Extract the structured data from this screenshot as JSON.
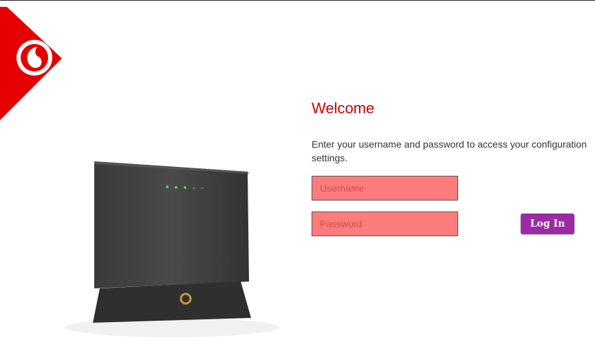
{
  "brand": {
    "logo": "vodafone-logo-icon",
    "accent_color": "#e60000",
    "button_color": "#9c2aa0"
  },
  "login": {
    "welcome": "Welcome",
    "intro": "Enter your username and password to access your configuration settings.",
    "username_placeholder": "Username",
    "password_placeholder": "Password",
    "login_label": "Log In",
    "field_color": "#ff7c7c"
  }
}
